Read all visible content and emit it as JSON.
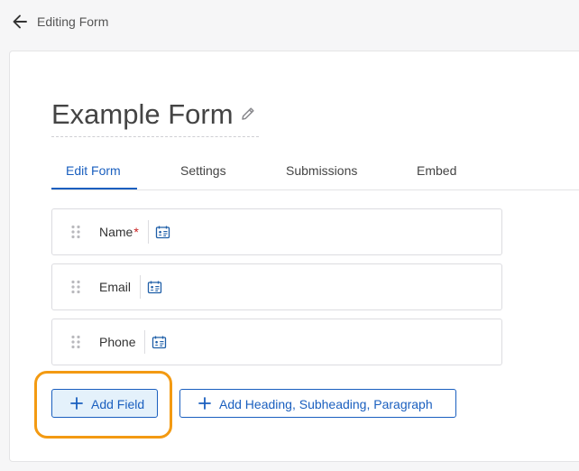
{
  "topbar": {
    "title": "Editing Form",
    "back_icon": "arrow-left-icon"
  },
  "form": {
    "title": "Example Form",
    "edit_icon": "pencil-icon"
  },
  "tabs": [
    {
      "label": "Edit Form",
      "active": true
    },
    {
      "label": "Settings",
      "active": false
    },
    {
      "label": "Submissions",
      "active": false
    },
    {
      "label": "Embed",
      "active": false
    }
  ],
  "fields": [
    {
      "label": "Name",
      "required": true,
      "required_mark": "*",
      "type_icon": "id-card-icon"
    },
    {
      "label": "Email",
      "required": false,
      "type_icon": "id-card-icon"
    },
    {
      "label": "Phone",
      "required": false,
      "type_icon": "id-card-icon"
    }
  ],
  "actions": {
    "add_field_label": "Add Field",
    "add_heading_label": "Add Heading, Subheading, Paragraph"
  },
  "colors": {
    "accent": "#1a5fbf",
    "highlight": "#f39a12",
    "required": "#c81e1e"
  }
}
